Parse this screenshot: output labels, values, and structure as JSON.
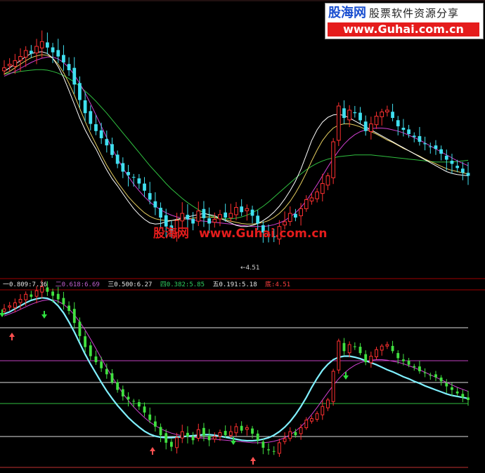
{
  "site": {
    "brand": "股海网",
    "slogan": "股票软件资源分享",
    "url": "www.Guhai.com.cn",
    "watermark_cn": "股海网",
    "watermark_url": "www.Guhai.com.cn"
  },
  "main_panel": {
    "low_marker_label": "←4.51"
  },
  "fib_levels": [
    {
      "label": "一0.809:7.36",
      "color": "#e8e8e8"
    },
    {
      "label": "二0.618:6.69",
      "color": "#c060d0"
    },
    {
      "label": "三0.500:6.27",
      "color": "#e8e8e8"
    },
    {
      "label": "四0.382:5.85",
      "color": "#30d060"
    },
    {
      "label": "五0.191:5.18",
      "color": "#e8e8e8"
    },
    {
      "label": "底:4.51",
      "color": "#ff4040"
    }
  ],
  "colors": {
    "up": "#ff3030",
    "down": "#40e0f0",
    "lower_down": "#40e040",
    "ma_short": "#ffffff",
    "ma_mid": "#e8d060",
    "ma_long": "#d040d0",
    "ma_trend": "#30c040",
    "lower_line_main": "#80f0ff",
    "lower_line_slow": "#d040d0",
    "separator": "#a00000"
  },
  "chart_data": {
    "type": "candlestick",
    "y_range": [
      4.35,
      8.35
    ],
    "fib_lines": [
      7.36,
      6.69,
      6.27,
      5.85,
      5.18,
      4.51
    ],
    "closes": [
      7.66,
      7.72,
      7.78,
      7.85,
      7.95,
      7.9,
      8.02,
      8.1,
      8.0,
      7.92,
      7.85,
      7.75,
      7.62,
      7.38,
      7.12,
      6.9,
      6.72,
      6.6,
      6.48,
      6.36,
      6.2,
      6.05,
      5.92,
      5.86,
      5.82,
      5.72,
      5.6,
      5.45,
      5.32,
      5.15,
      5.0,
      4.92,
      5.1,
      5.22,
      5.12,
      5.05,
      5.26,
      5.14,
      5.05,
      5.12,
      5.2,
      5.15,
      5.22,
      5.32,
      5.24,
      5.3,
      5.18,
      5.05,
      4.9,
      4.85,
      4.82,
      5.0,
      5.08,
      5.22,
      5.15,
      5.3,
      5.45,
      5.48,
      5.58,
      5.72,
      5.85,
      6.42,
      7.02,
      6.82,
      6.95,
      6.9,
      6.78,
      6.6,
      6.72,
      6.85,
      6.92,
      6.95,
      6.82,
      6.68,
      6.62,
      6.55,
      6.5,
      6.42,
      6.38,
      6.34,
      6.3,
      6.22,
      6.12,
      6.05,
      5.98,
      5.9,
      5.85
    ],
    "ma_short": [
      7.6,
      7.66,
      7.72,
      7.78,
      7.85,
      7.9,
      7.92,
      7.93,
      7.9,
      7.82,
      7.68,
      7.5,
      7.28,
      7.05,
      6.82,
      6.62,
      6.45,
      6.3,
      6.12,
      5.95,
      5.8,
      5.68,
      5.55,
      5.42,
      5.3,
      5.2,
      5.12,
      5.06,
      5.04,
      5.05,
      5.08,
      5.1,
      5.12,
      5.14,
      5.16,
      5.18,
      5.2,
      5.22,
      5.2,
      5.18,
      5.14,
      5.1,
      5.06,
      5.02,
      5.0,
      5.0,
      5.02,
      5.05,
      5.1,
      5.16,
      5.24,
      5.34,
      5.46,
      5.6,
      5.76,
      5.96,
      6.2,
      6.44,
      6.62,
      6.75,
      6.83,
      6.87,
      6.88,
      6.86,
      6.82,
      6.77,
      6.72,
      6.67,
      6.62,
      6.57,
      6.52,
      6.47,
      6.42,
      6.37,
      6.32,
      6.27,
      6.22,
      6.17,
      6.12,
      6.07,
      6.02,
      5.97,
      5.92,
      5.89,
      5.87,
      5.86,
      5.85
    ],
    "ma_mid": [
      7.56,
      7.6,
      7.66,
      7.72,
      7.78,
      7.83,
      7.86,
      7.88,
      7.87,
      7.82,
      7.72,
      7.58,
      7.4,
      7.2,
      6.98,
      6.76,
      6.56,
      6.38,
      6.2,
      6.03,
      5.88,
      5.74,
      5.62,
      5.5,
      5.4,
      5.31,
      5.23,
      5.17,
      5.13,
      5.11,
      5.1,
      5.1,
      5.11,
      5.12,
      5.13,
      5.14,
      5.15,
      5.16,
      5.16,
      5.15,
      5.13,
      5.11,
      5.09,
      5.07,
      5.05,
      5.04,
      5.04,
      5.05,
      5.07,
      5.1,
      5.15,
      5.22,
      5.31,
      5.42,
      5.56,
      5.72,
      5.9,
      6.1,
      6.28,
      6.44,
      6.56,
      6.65,
      6.7,
      6.72,
      6.72,
      6.7,
      6.67,
      6.63,
      6.59,
      6.55,
      6.5,
      6.45,
      6.41,
      6.36,
      6.31,
      6.27,
      6.22,
      6.18,
      6.13,
      6.09,
      6.05,
      6.01,
      5.97,
      5.94,
      5.92,
      5.9,
      5.88
    ],
    "ma_long": [
      7.52,
      7.56,
      7.6,
      7.65,
      7.7,
      7.75,
      7.79,
      7.82,
      7.84,
      7.84,
      7.81,
      7.75,
      7.66,
      7.54,
      7.4,
      7.24,
      7.06,
      6.87,
      6.68,
      6.49,
      6.31,
      6.14,
      5.98,
      5.84,
      5.71,
      5.6,
      5.5,
      5.41,
      5.34,
      5.28,
      5.23,
      5.19,
      5.16,
      5.14,
      5.12,
      5.11,
      5.1,
      5.09,
      5.08,
      5.07,
      5.06,
      5.05,
      5.04,
      5.03,
      5.02,
      5.01,
      5.0,
      5.0,
      5.0,
      5.01,
      5.03,
      5.06,
      5.1,
      5.16,
      5.23,
      5.32,
      5.43,
      5.56,
      5.7,
      5.85,
      6.0,
      6.14,
      6.27,
      6.38,
      6.47,
      6.54,
      6.59,
      6.62,
      6.64,
      6.65,
      6.65,
      6.64,
      6.62,
      6.6,
      6.57,
      6.53,
      6.49,
      6.45,
      6.4,
      6.35,
      6.3,
      6.25,
      6.2,
      6.15,
      6.1,
      6.06,
      6.02
    ],
    "ma_trend": [
      7.55,
      7.57,
      7.58,
      7.6,
      7.61,
      7.62,
      7.63,
      7.63,
      7.62,
      7.6,
      7.57,
      7.53,
      7.48,
      7.42,
      7.35,
      7.27,
      7.19,
      7.1,
      7.0,
      6.9,
      6.79,
      6.68,
      6.57,
      6.46,
      6.35,
      6.24,
      6.13,
      6.02,
      5.92,
      5.82,
      5.72,
      5.63,
      5.55,
      5.47,
      5.4,
      5.34,
      5.28,
      5.23,
      5.19,
      5.16,
      5.14,
      5.13,
      5.13,
      5.14,
      5.16,
      5.19,
      5.23,
      5.28,
      5.34,
      5.41,
      5.49,
      5.57,
      5.65,
      5.73,
      5.81,
      5.88,
      5.95,
      6.01,
      6.06,
      6.1,
      6.13,
      6.15,
      6.17,
      6.18,
      6.19,
      6.2,
      6.2,
      6.2,
      6.2,
      6.19,
      6.18,
      6.17,
      6.16,
      6.15,
      6.14,
      6.13,
      6.12,
      6.11,
      6.1,
      6.09,
      6.08,
      6.08,
      6.08,
      6.08,
      6.09,
      6.1,
      6.11
    ]
  }
}
